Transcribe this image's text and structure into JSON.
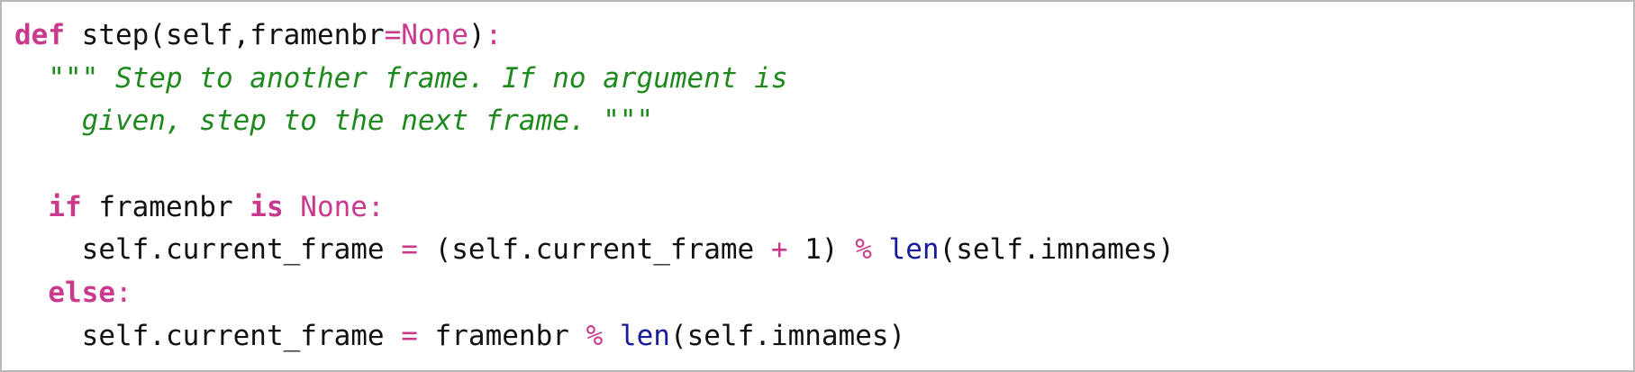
{
  "colors": {
    "keyword": "#c93a8c",
    "builtin": "#1a1a9c",
    "docstring": "#1e8a1e",
    "text": "#111111",
    "border": "#b8b8b8"
  },
  "code": {
    "lines": [
      {
        "indent": "",
        "tokens": [
          {
            "t": "def",
            "c": "kw"
          },
          {
            "t": " step(self,framenbr",
            "c": "plain"
          },
          {
            "t": "=",
            "c": "op"
          },
          {
            "t": "None",
            "c": "const"
          },
          {
            "t": ")",
            "c": "plain"
          },
          {
            "t": ":",
            "c": "op"
          }
        ]
      },
      {
        "indent": "  ",
        "tokens": [
          {
            "t": "\"\"\" Step to another frame. If no argument is",
            "c": "doc"
          }
        ]
      },
      {
        "indent": "    ",
        "tokens": [
          {
            "t": "given, step to the next frame. \"\"\"",
            "c": "doc"
          }
        ]
      },
      {
        "indent": "",
        "tokens": []
      },
      {
        "indent": "  ",
        "tokens": [
          {
            "t": "if",
            "c": "kw"
          },
          {
            "t": " framenbr ",
            "c": "plain"
          },
          {
            "t": "is",
            "c": "kw"
          },
          {
            "t": " ",
            "c": "plain"
          },
          {
            "t": "None",
            "c": "const"
          },
          {
            "t": ":",
            "c": "op"
          }
        ]
      },
      {
        "indent": "    ",
        "tokens": [
          {
            "t": "self.current_frame ",
            "c": "plain"
          },
          {
            "t": "=",
            "c": "op"
          },
          {
            "t": " (self.current_frame ",
            "c": "plain"
          },
          {
            "t": "+",
            "c": "op"
          },
          {
            "t": " 1) ",
            "c": "plain"
          },
          {
            "t": "%",
            "c": "op"
          },
          {
            "t": " ",
            "c": "plain"
          },
          {
            "t": "len",
            "c": "builtin"
          },
          {
            "t": "(self.imnames)",
            "c": "plain"
          }
        ]
      },
      {
        "indent": "  ",
        "tokens": [
          {
            "t": "else",
            "c": "kw"
          },
          {
            "t": ":",
            "c": "op"
          }
        ]
      },
      {
        "indent": "    ",
        "tokens": [
          {
            "t": "self.current_frame ",
            "c": "plain"
          },
          {
            "t": "=",
            "c": "op"
          },
          {
            "t": " framenbr ",
            "c": "plain"
          },
          {
            "t": "%",
            "c": "op"
          },
          {
            "t": " ",
            "c": "plain"
          },
          {
            "t": "len",
            "c": "builtin"
          },
          {
            "t": "(self.imnames)",
            "c": "plain"
          }
        ]
      }
    ]
  }
}
